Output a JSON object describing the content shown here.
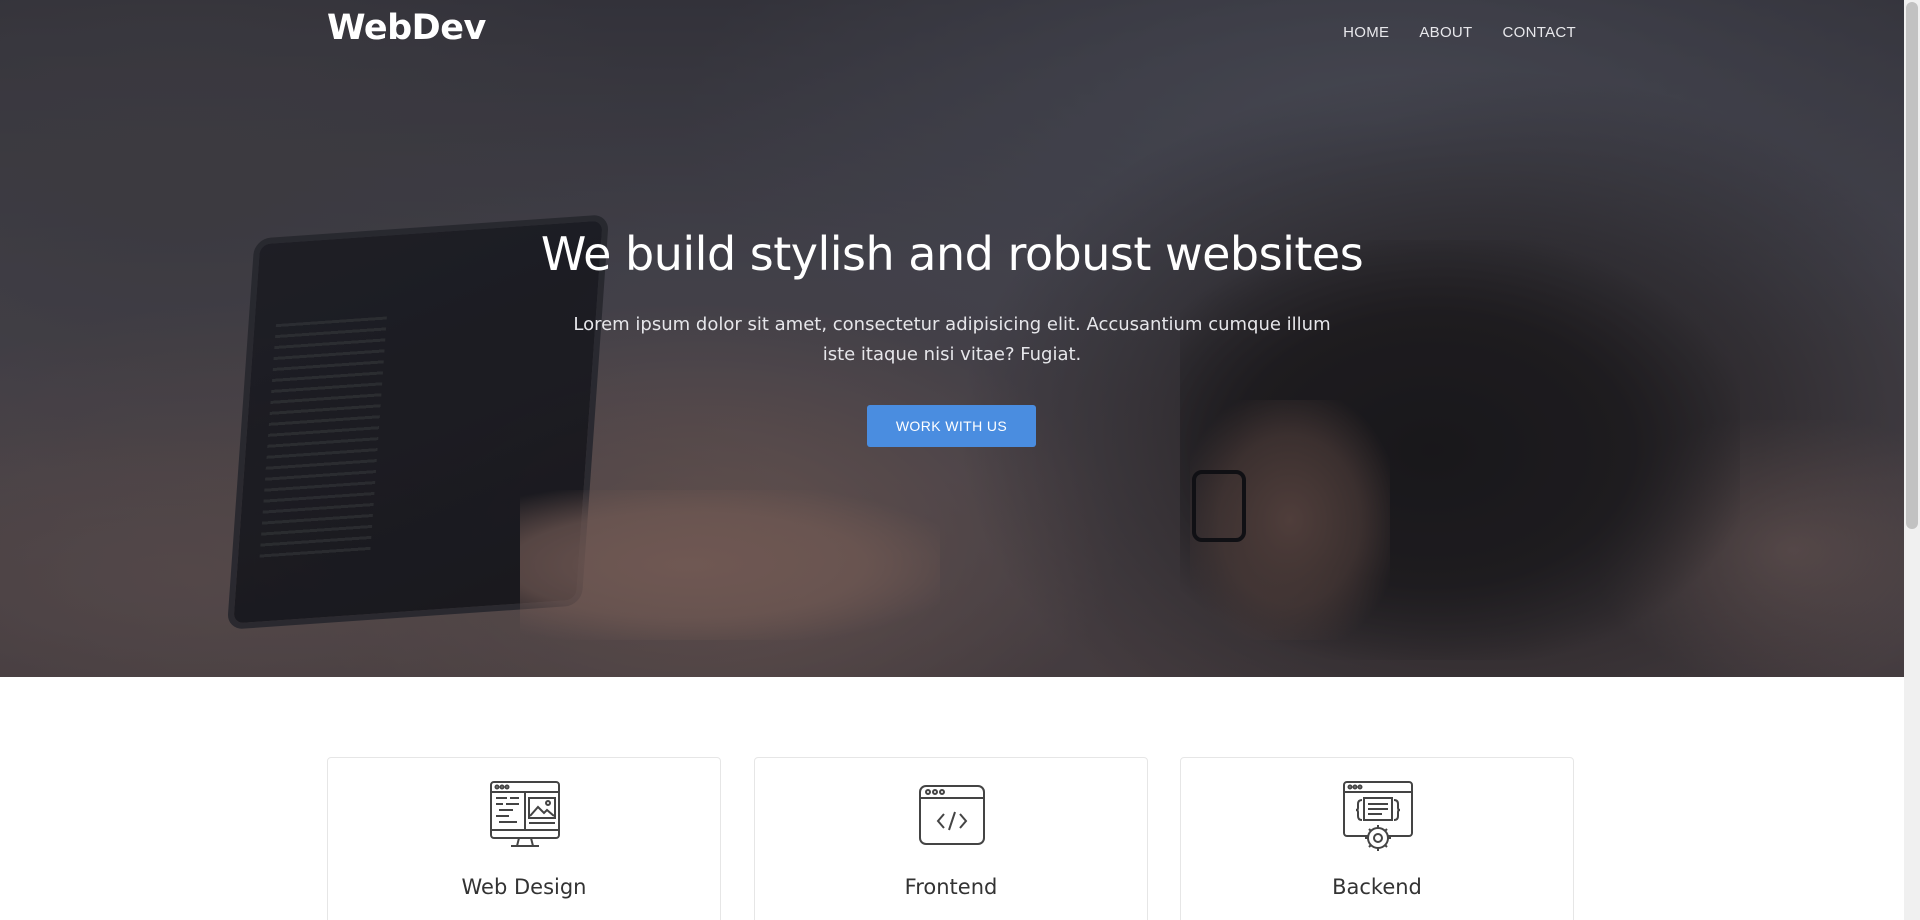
{
  "brand": {
    "logo": "WebDev"
  },
  "nav": {
    "items": [
      {
        "label": "HOME"
      },
      {
        "label": "ABOUT"
      },
      {
        "label": "CONTACT"
      }
    ]
  },
  "hero": {
    "title": "We build stylish and robust websites",
    "subtitle": "Lorem ipsum dolor sit amet, consectetur adipisicing elit. Accusantium cumque illum iste itaque nisi vitae? Fugiat.",
    "cta_label": "WORK WITH US",
    "background_image": "person-working-on-laptop-on-couch"
  },
  "services": {
    "cards": [
      {
        "title": "Web Design",
        "icon": "web-design-icon"
      },
      {
        "title": "Frontend",
        "icon": "code-window-icon"
      },
      {
        "title": "Backend",
        "icon": "server-settings-icon"
      }
    ]
  },
  "colors": {
    "accent": "#4a8de0",
    "text_dark": "#333333",
    "white": "#ffffff"
  }
}
